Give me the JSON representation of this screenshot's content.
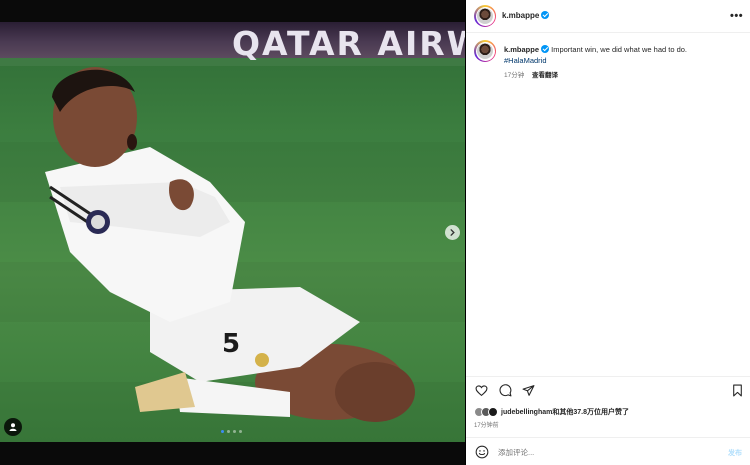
{
  "media": {
    "banner_text": "QATAR AIRW",
    "jersey_number": "5",
    "carousel": {
      "count": 4,
      "active_index": 0
    }
  },
  "header": {
    "username": "k.mbappe",
    "more_label": "•••"
  },
  "caption": {
    "username": "k.mbappe",
    "text": "Important win, we did what we had to do.",
    "hashtag": "#HalaMadrid",
    "time": "17分钟",
    "translate": "查看翻译"
  },
  "likes": {
    "text": "judebellingham和其他37.8万位用户赞了",
    "time": "17分钟前"
  },
  "comment": {
    "placeholder": "添加评论...",
    "post_label": "发布"
  },
  "colors": {
    "verified": "#0095f6",
    "hashtag": "#00376b",
    "post_button": "#b2dffc",
    "carousel_active": "#3d8cf4"
  },
  "icons": {
    "heart": "heart-icon",
    "comment": "comment-icon",
    "share": "share-icon",
    "save": "bookmark-icon",
    "emoji": "emoji-icon",
    "next": "chevron-right-icon",
    "tag": "user-tag-icon"
  }
}
